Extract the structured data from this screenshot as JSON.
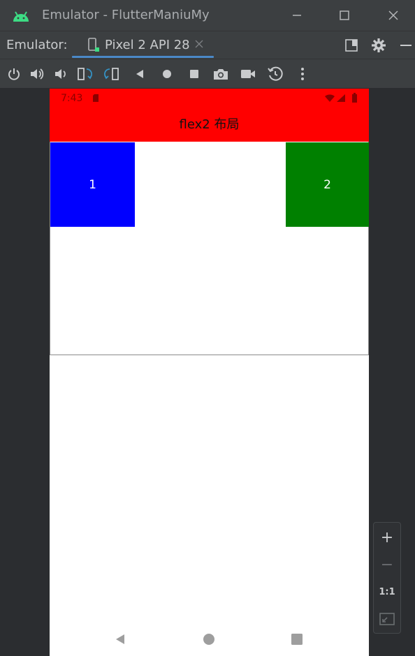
{
  "window": {
    "title": "Emulator - FlutterManiuMy",
    "controls": [
      "minimize",
      "maximize",
      "close"
    ]
  },
  "tabbar": {
    "label": "Emulator:",
    "tab": {
      "label": "Pixel 2 API 28",
      "icon": "device-icon",
      "active": true
    },
    "right_icons": [
      "split-panel-icon",
      "gear-icon",
      "minimize-panel-icon"
    ]
  },
  "toolbar": {
    "icons": [
      "power-icon",
      "volume-up-icon",
      "volume-down-icon",
      "rotate-left-icon",
      "rotate-right-icon",
      "back-icon",
      "home-icon",
      "overview-icon",
      "camera-icon",
      "video-icon",
      "snapshot-icon",
      "more-icon"
    ]
  },
  "device": {
    "status_bar": {
      "time": "7:43",
      "color": "#ff0000"
    },
    "app_bar": {
      "title": "flex2 布局",
      "color": "#ff0000"
    },
    "boxes": [
      {
        "label": "1",
        "color": "#0000ff"
      },
      {
        "label": "2",
        "color": "#008000"
      }
    ],
    "nav_bar": [
      "back",
      "home",
      "recents"
    ]
  },
  "zoom": {
    "zoom_in": "+",
    "zoom_out": "−",
    "actual_size": "1:1",
    "fit": "fit-screen-icon"
  }
}
